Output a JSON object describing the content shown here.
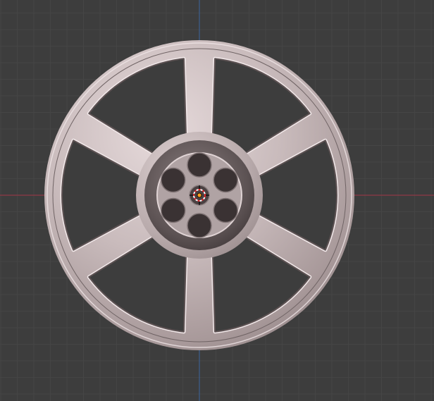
{
  "app": {
    "name": "3D Viewport"
  },
  "viewport": {
    "background_color": "#3d3d3d",
    "grid_minor_color": "#454545",
    "grid_major_color": "#4c4c4c",
    "x_axis_color": "#8f3a45",
    "y_axis_color": "#3d5f8f"
  },
  "scene": {
    "object": {
      "name": "wheel",
      "type": "six-spoke wheel rim",
      "material_color": "#c4b7b8",
      "spoke_count": 6,
      "lug_hole_count": 6,
      "selected": false
    },
    "origin": {
      "icon": "object-origin-icon",
      "color": "#ff9f1c"
    },
    "cursor_3d": {
      "icon": "3d-cursor-icon",
      "color_a": "#ffffff",
      "color_b": "#e0242a"
    }
  }
}
